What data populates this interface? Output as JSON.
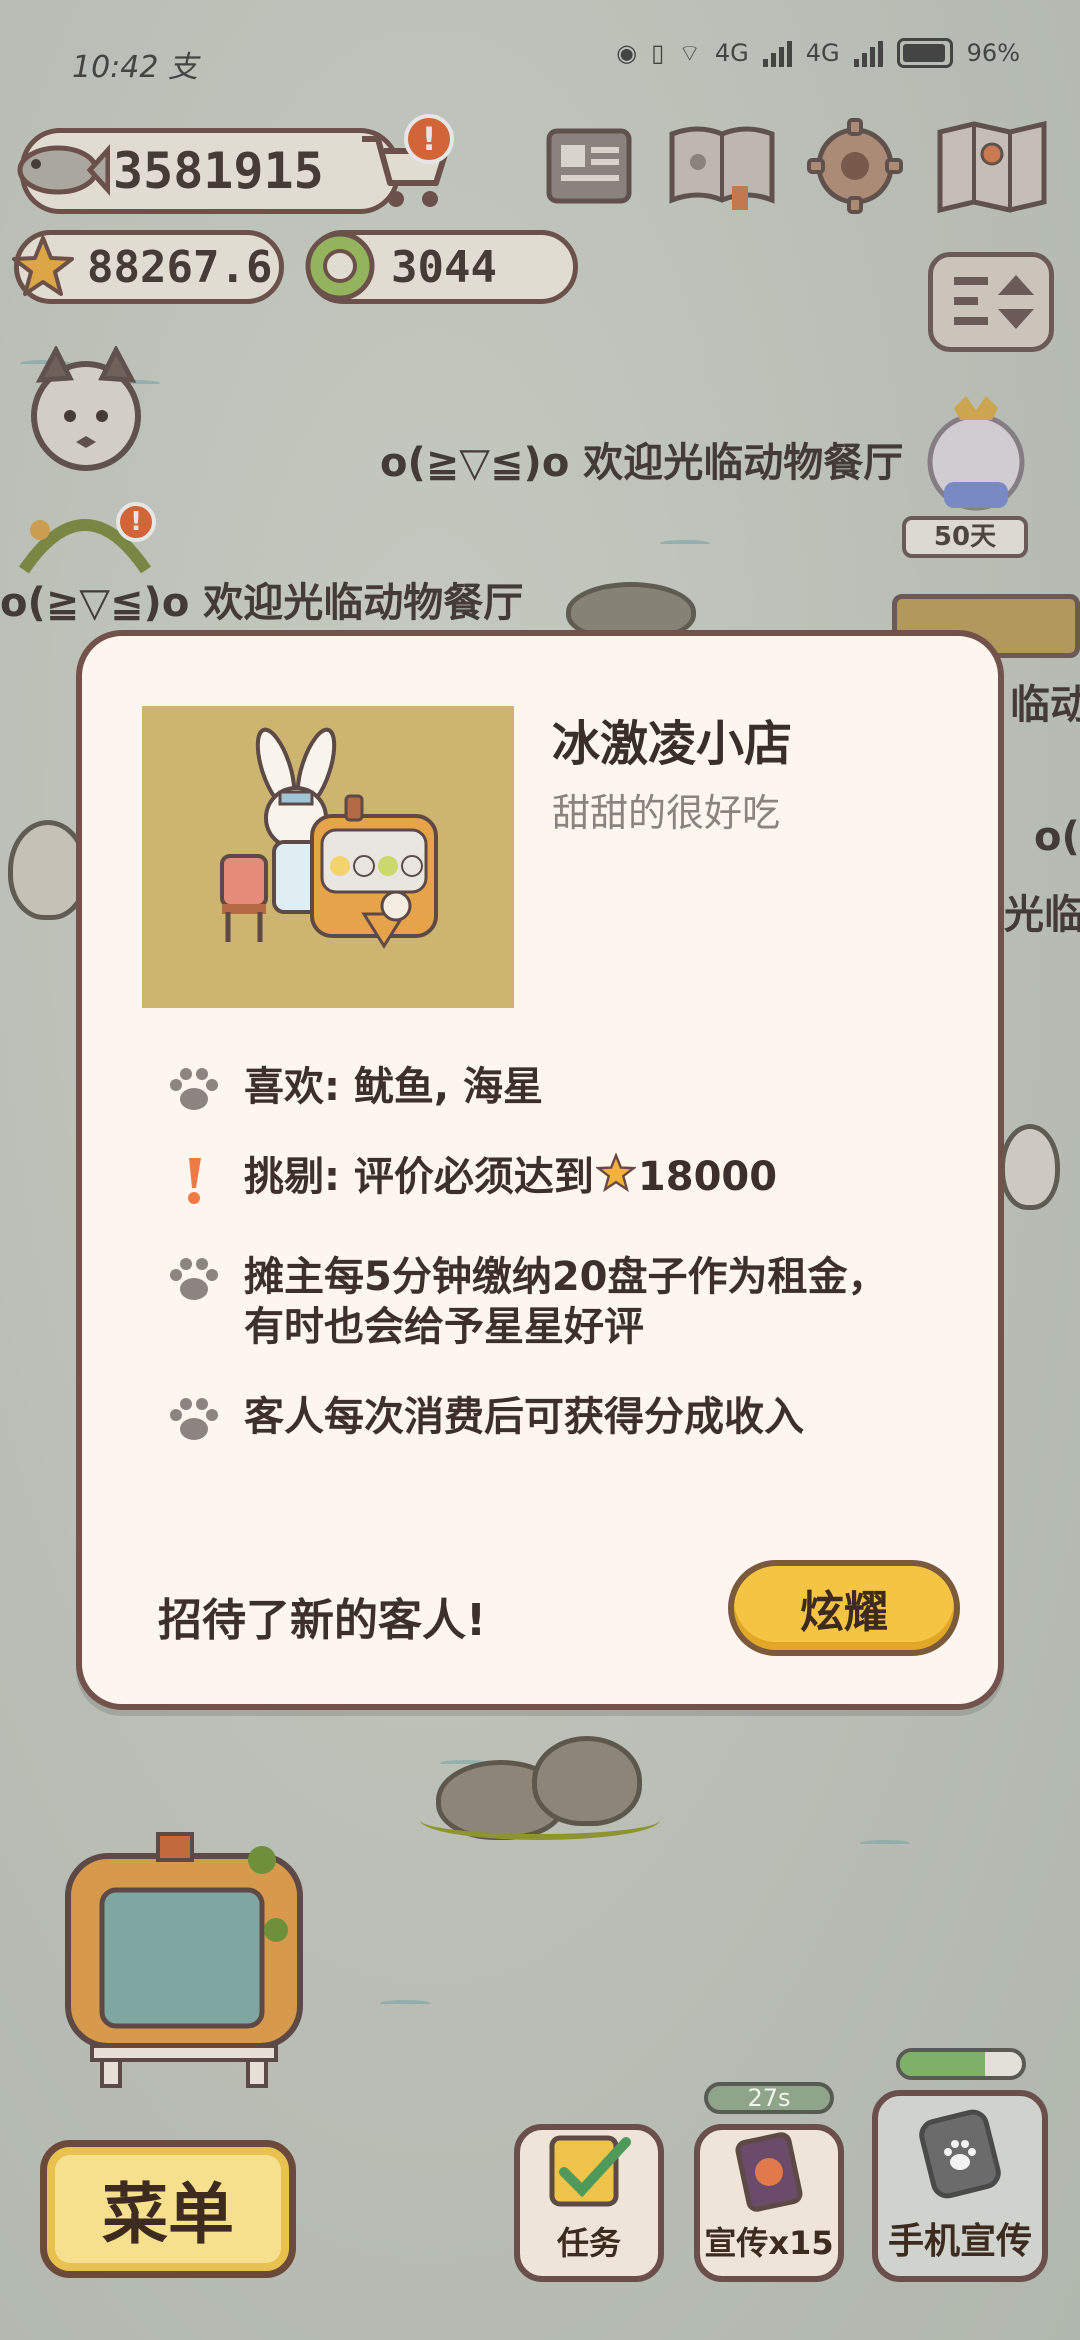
{
  "status_bar": {
    "time": "10:42",
    "time_suffix": "支",
    "network_1": "4G",
    "network_2": "4G",
    "battery": "96%"
  },
  "hud": {
    "fish_count": "3581915",
    "star_rating": "88267.6",
    "ring_count": "3044",
    "cart_alert": "!"
  },
  "scene": {
    "welcome_text": "o(≧▽≦)o 欢迎光临动物餐厅",
    "day_badge": "50天",
    "right_fragment_1": "临动",
    "right_fragment_2": "o(≧",
    "right_fragment_3": "光临"
  },
  "shop_modal": {
    "title": "冰激凌小店",
    "subtitle": "甜甜的很好吃",
    "likes": "喜欢: 鱿鱼, 海星",
    "picky_prefix": "挑剔: 评价必须达到",
    "picky_value": "18000",
    "rent_info": "摊主每5分钟缴纳20盘子作为租金，有时也会给予星星好评",
    "revenue_info": "客人每次消费后可获得分成收入",
    "footer_message": "招待了新的客人!",
    "show_off_button": "炫耀"
  },
  "bottom_bar": {
    "menu_label": "菜单",
    "tasks_label": "任务",
    "promo_label": "宣传x15",
    "promo_timer": "27s",
    "phone_promo_label": "手机宣传",
    "phone_promo_progress": 0.7
  },
  "colors": {
    "accent_yellow": "#f5c443",
    "border_brown": "#74524c",
    "modal_bg": "#fdf6ee",
    "alert_orange": "#e8622c"
  }
}
